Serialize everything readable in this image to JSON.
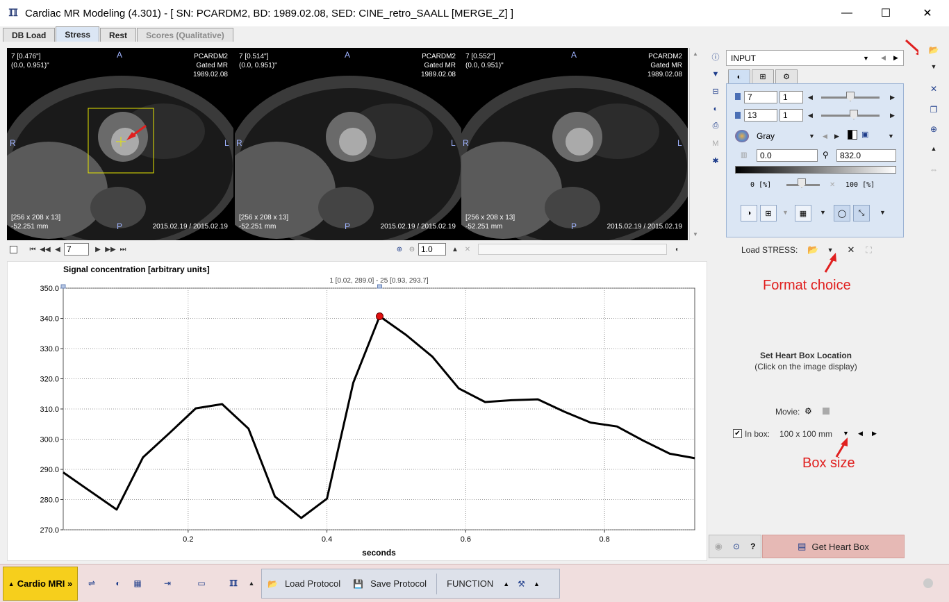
{
  "window": {
    "title": "Cardiac MR Modeling (4.301) - [ SN: PCARDM2, BD: 1989.02.08, SED: CINE_retro_SAALL  [MERGE_Z] ]",
    "minimize": "—",
    "maximize": "☐",
    "close": "✕"
  },
  "tabs": [
    {
      "label": "DB Load"
    },
    {
      "label": "Stress"
    },
    {
      "label": "Rest"
    },
    {
      "label": "Scores (Qualitative)"
    }
  ],
  "viewer": {
    "panes": [
      {
        "top_left_1": "7 [0.476\"]",
        "top_left_2": "(0.0, 0.951)\"",
        "top_right_1": "PCARDM2",
        "top_right_2": "Gated MR",
        "top_right_3": "1989.02.08",
        "bottom_left_1": "[256 x 208 x 13]",
        "bottom_left_2": "-52.251 mm",
        "bottom_right": "2015.02.19 / 2015.02.19"
      },
      {
        "top_left_1": "7 [0.514\"]",
        "top_left_2": "(0.0, 0.951)\"",
        "top_right_1": "PCARDM2",
        "top_right_2": "Gated MR",
        "top_right_3": "1989.02.08",
        "bottom_left_1": "[256 x 208 x 13]",
        "bottom_left_2": "-52.251 mm",
        "bottom_right": "2015.02.19 / 2015.02.19"
      },
      {
        "top_left_1": "7 [0.552\"]",
        "top_left_2": "(0.0, 0.951)\"",
        "top_right_1": "PCARDM2",
        "top_right_2": "Gated MR",
        "top_right_3": "1989.02.08",
        "bottom_left_1": "[256 x 208 x 13]",
        "bottom_left_2": "-52.251 mm",
        "bottom_right": "2015.02.19 / 2015.02.19"
      }
    ],
    "orient": {
      "top": "A",
      "bottom": "P",
      "left": "R",
      "right": "L"
    }
  },
  "navbar": {
    "frame_value": "7",
    "zoom_value": "1.0"
  },
  "chart_data": {
    "type": "line",
    "title": "Signal concentration [arbitrary units]",
    "subtitle": "1 [0.02, 289.0] - 25 [0.93, 293.7]",
    "xlabel": "seconds",
    "ylabel": "",
    "xlim": [
      0.02,
      0.93
    ],
    "ylim": [
      270.0,
      350.0
    ],
    "x_ticks": [
      "0.2",
      "0.4",
      "0.6",
      "0.8"
    ],
    "y_ticks": [
      "270.0",
      "280.0",
      "290.0",
      "300.0",
      "310.0",
      "320.0",
      "330.0",
      "340.0",
      "350.0"
    ],
    "grid": true,
    "series": [
      {
        "x": [
          0.02,
          0.097,
          0.135,
          0.173,
          0.211,
          0.249,
          0.287,
          0.325,
          0.363,
          0.4,
          0.438,
          0.476,
          0.514,
          0.552,
          0.59,
          0.628,
          0.666,
          0.704,
          0.742,
          0.78,
          0.818,
          0.856,
          0.894,
          0.93
        ],
        "y": [
          289.0,
          276.7,
          294.0,
          302.0,
          310.2,
          311.6,
          303.5,
          281.0,
          273.9,
          280.3,
          318.7,
          340.7,
          334.5,
          327.3,
          316.8,
          312.3,
          312.9,
          313.2,
          309.1,
          305.5,
          304.2,
          299.5,
          295.2,
          293.7
        ]
      }
    ],
    "marker": {
      "x": 0.476,
      "y": 340.7
    }
  },
  "control_panel": {
    "input_select": "INPUT",
    "slice_value": "7",
    "slice_step": "1",
    "frame_value": "13",
    "frame_step": "1",
    "colortable": "Gray",
    "min_value": "0.0",
    "max_value": "832.0",
    "lower_pct": "0",
    "upper_pct": "100",
    "pct_unit": "[%]"
  },
  "load_row": {
    "label": "Load STRESS:"
  },
  "annotations": {
    "format_choice": "Format choice",
    "box_size": "Box size"
  },
  "heart_box": {
    "title": "Set Heart Box Location",
    "subtitle": "(Click on the image display)",
    "movie_label": "Movie:",
    "in_box_label": "In box:",
    "box_size_value": "100 x 100 mm",
    "get_button": "Get Heart Box"
  },
  "statusbar": {
    "cardio_label": "Cardio MRI »",
    "load_protocol": "Load Protocol",
    "save_protocol": "Save Protocol",
    "function_label": "FUNCTION"
  },
  "colors": {
    "accent_yellow": "#f6cf1c",
    "heart_button": "#e6b9b5",
    "annotation_red": "#e0201f",
    "marker_red": "#e01010"
  }
}
